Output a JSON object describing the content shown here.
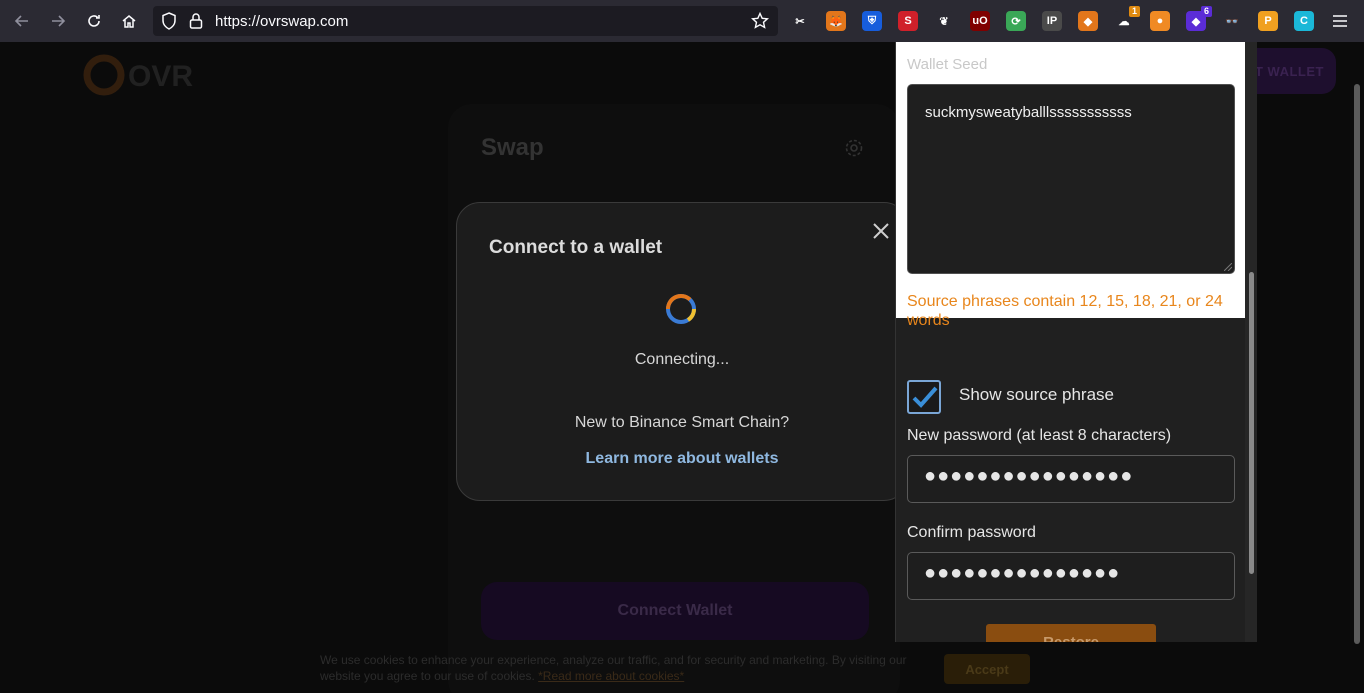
{
  "browser": {
    "url": "https://ovrswap.com",
    "extensions": [
      {
        "name": "screenshot-ext-icon",
        "color": "#2b2a33",
        "glyph": "✂",
        "badge": ""
      },
      {
        "name": "metamask-icon",
        "color": "#e2761b",
        "glyph": "🦊",
        "badge": ""
      },
      {
        "name": "bitwarden-icon",
        "color": "#175ddc",
        "glyph": "⛨",
        "badge": ""
      },
      {
        "name": "s-ext-icon",
        "color": "#d0202a",
        "glyph": "S",
        "badge": ""
      },
      {
        "name": "bird-ext-icon",
        "color": "#2b2a33",
        "glyph": "❦",
        "badge": ""
      },
      {
        "name": "ublock-icon",
        "color": "#800000",
        "glyph": "uO",
        "badge": ""
      },
      {
        "name": "green-ext-icon",
        "color": "#3aa757",
        "glyph": "⟳",
        "badge": ""
      },
      {
        "name": "ip-ext-icon",
        "color": "#4a4a4a",
        "glyph": "IP",
        "badge": ""
      },
      {
        "name": "fox-ext-icon",
        "color": "#e2761b",
        "glyph": "◆",
        "badge": ""
      },
      {
        "name": "ghost-ext-icon",
        "color": "#2b2a33",
        "glyph": "☁",
        "badge": "1"
      },
      {
        "name": "orange-ext-icon",
        "color": "#f08a24",
        "glyph": "●",
        "badge": ""
      },
      {
        "name": "purple-ext-icon",
        "color": "#5b2cd6",
        "glyph": "◆",
        "badge": "6"
      },
      {
        "name": "glasses-ext-icon",
        "color": "#2b2a33",
        "glyph": "👓",
        "badge": ""
      },
      {
        "name": "p-ext-icon",
        "color": "#f0a020",
        "glyph": "P",
        "badge": ""
      },
      {
        "name": "c-ext-icon",
        "color": "#1bb8d8",
        "glyph": "C",
        "badge": ""
      }
    ]
  },
  "dapp": {
    "top_button": "CT WALLET",
    "swap_title": "Swap",
    "connect_wallet": "Connect Wallet",
    "cookie_text": "We use cookies to enhance your experience, analyze our traffic, and for security and marketing. By visiting our website you agree to our use of cookies.",
    "cookie_link": "*Read more about cookies*",
    "cookie_accept": "Accept"
  },
  "modal": {
    "title": "Connect to a wallet",
    "status": "Connecting...",
    "new_to": "New to Binance Smart Chain?",
    "learn_more": "Learn more about wallets"
  },
  "popup": {
    "seed_label": "Wallet Seed",
    "seed_value": "suckmysweatyballlsssssssssss",
    "warning": "Source phrases contain 12, 15, 18, 21, or 24 words",
    "show_phrase_label": "Show source phrase",
    "show_phrase_checked": true,
    "new_password_label": "New password (at least 8 characters)",
    "new_password_value": "●●●●●●●●●●●●●●●●",
    "confirm_password_label": "Confirm password",
    "confirm_password_value": "●●●●●●●●●●●●●●●",
    "restore_button": "Restore"
  }
}
